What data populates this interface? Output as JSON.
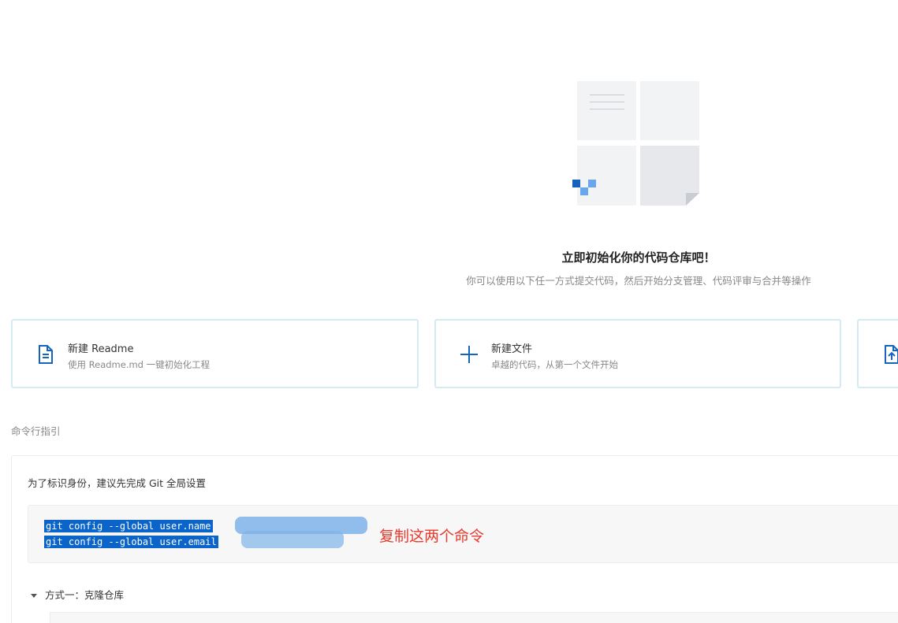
{
  "hero": {
    "title": "立即初始化你的代码仓库吧！",
    "subtitle": "你可以使用以下任一方式提交代码，然后开始分支管理、代码评审与合并等操作"
  },
  "cards": [
    {
      "title": "新建 Readme",
      "desc": "使用 Readme.md 一键初始化工程",
      "icon": "document-icon"
    },
    {
      "title": "新建文件",
      "desc": "卓越的代码，从第一个文件开始",
      "icon": "plus-icon"
    },
    {
      "title": "",
      "desc": "",
      "icon": "upload-file-icon"
    }
  ],
  "section_label": "命令行指引",
  "panel": {
    "title": "为了标识身份，建议先完成 Git 全局设置",
    "commands": [
      "git config --global user.name",
      "git config --global user.email"
    ],
    "annotation": "复制这两个命令",
    "method_label": "方式一：克隆仓库"
  },
  "colors": {
    "accent": "#1565c0",
    "card_border": "#d5ebf3",
    "annotation": "#e53b2e",
    "selection": "#0a64c9"
  }
}
